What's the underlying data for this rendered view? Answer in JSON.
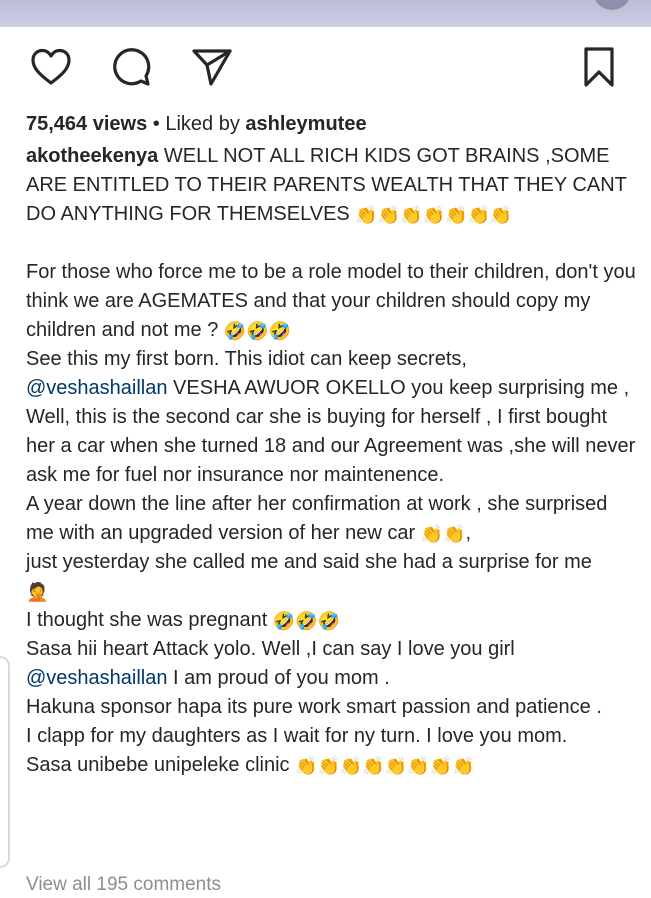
{
  "post": {
    "views": "75,464 views",
    "separator": " • ",
    "liked_by_prefix": "Liked by ",
    "liked_by_user": "ashleymutee",
    "username": "akotheekenya",
    "view_comments": "View all 195 comments"
  },
  "actions": {
    "like_icon": "heart-icon",
    "comment_icon": "comment-icon",
    "share_icon": "send-icon",
    "save_icon": "bookmark-icon"
  },
  "caption_lines": [
    "WELL NOT ALL RICH KIDS GOT BRAINS ,SOME ARE ENTITLED TO THEIR PARENTS WEALTH THAT THEY CANT DO ANYTHING FOR THEMSELVES ",
    "For those who force me to be a role model to their children, don't you think we are AGEMATES and that your children should copy my children and not me ? ",
    "See this my first born. This idiot can keep secrets,",
    "@veshashaillan",
    " VESHA AWUOR OKELLO you keep surprising me ,",
    "Well, this is the second car she is buying for  herself , I first bought her a car when she turned 18 and our Agreement was ,she will never ask me for fuel nor insurance nor maintenence.",
    "A year down the line  after her confirmation at work , she surprised me with an upgraded version of her new car ",
    ",",
    "just yesterday she called me and said she had a surprise for me",
    "I thought she was pregnant ",
    "Sasa hii heart Attack yolo. Well ,I can say I love you girl",
    "@veshashaillan",
    " I am proud of you mom .",
    "Hakuna sponsor hapa  its pure work smart passion and patience .",
    "I clapp for my daughters as I wait for ny turn. I love you mom.",
    "Sasa unibebe unipeleke clinic "
  ],
  "emojis": {
    "clap": "👏",
    "rofl": "🤣",
    "facepalm": "🤦"
  },
  "colors": {
    "text": "#262626",
    "mention": "#00376b",
    "muted": "#8e8e8e"
  }
}
